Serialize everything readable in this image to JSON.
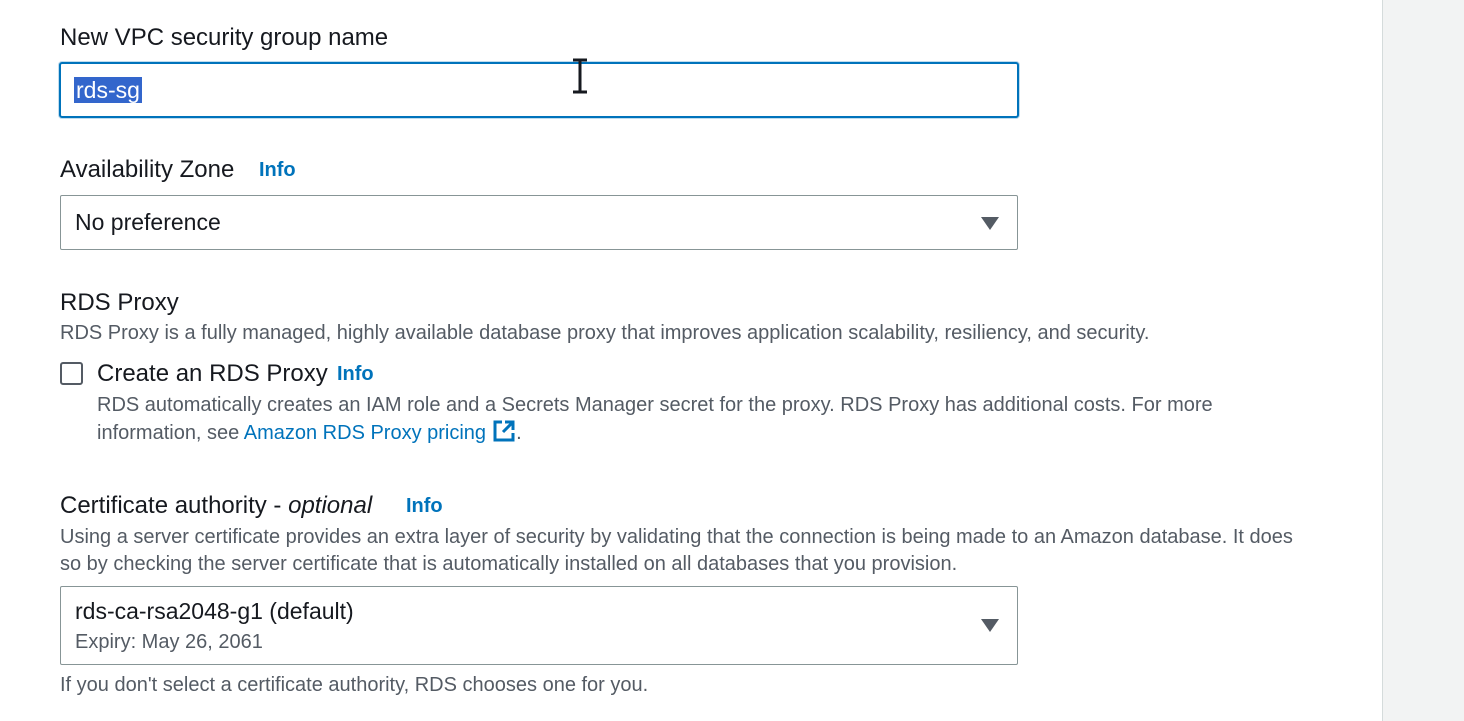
{
  "security_group": {
    "label": "New VPC security group name",
    "value": "rds-sg"
  },
  "availability_zone": {
    "label": "Availability Zone",
    "info": "Info",
    "selected": "No preference"
  },
  "rds_proxy": {
    "title": "RDS Proxy",
    "description": "RDS Proxy is a fully managed, highly available database proxy that improves application scalability, resiliency, and security.",
    "checkbox_label": "Create an RDS Proxy",
    "info": "Info",
    "checked": false,
    "help_line1": "RDS automatically creates an IAM role and a Secrets Manager secret for the proxy. RDS Proxy has additional costs. For more",
    "help_prefix": "information, see ",
    "pricing_link": "Amazon RDS Proxy pricing",
    "help_suffix": "."
  },
  "certificate_authority": {
    "label": "Certificate authority - ",
    "optional": "optional",
    "info": "Info",
    "description_line1": "Using a server certificate provides an extra layer of security by validating that the connection is being made to an Amazon database. It does",
    "description_line2": "so by checking the server certificate that is automatically installed on all databases that you provision.",
    "selected": "rds-ca-rsa2048-g1 (default)",
    "selected_sub": "Expiry: May 26, 2061",
    "footer": "If you don't select a certificate authority, RDS chooses one for you."
  },
  "colors": {
    "link": "#0073bb",
    "focus_border": "#0073bb",
    "selection": "#3366cc"
  },
  "icons": {
    "dropdown": "caret-down-icon",
    "external": "external-link-icon",
    "cursor": "text-cursor-icon"
  }
}
